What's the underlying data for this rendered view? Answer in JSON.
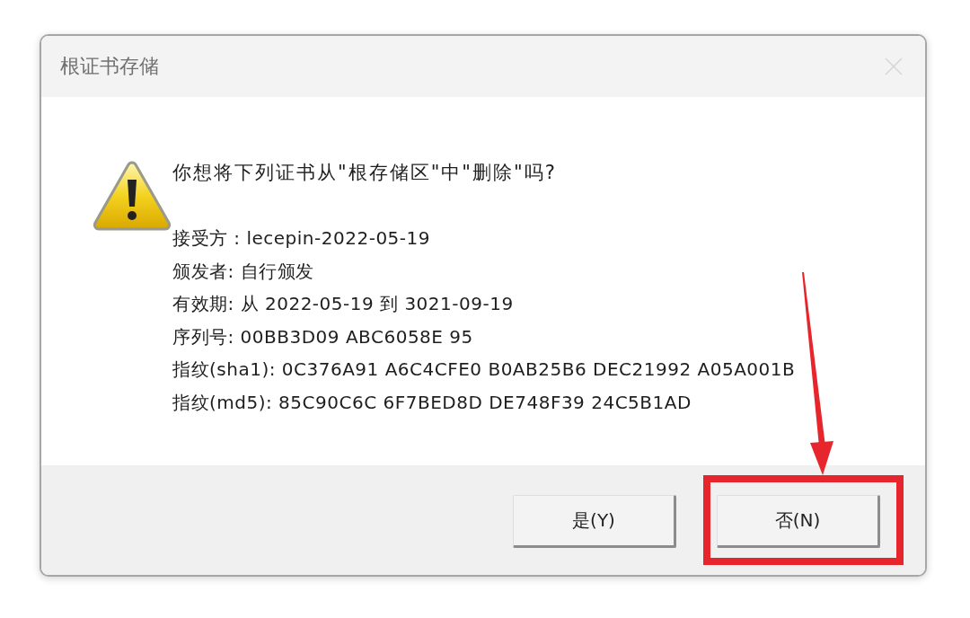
{
  "dialog": {
    "title": "根证书存储",
    "close_button": {
      "disabled": true
    },
    "message": "你想将下列证书从\"根存储区\"中\"删除\"吗?",
    "details": [
      "接受方 : lecepin-2022-05-19",
      "颁发者: 自行颁发",
      "有效期: 从 2022-05-19 到 3021-09-19",
      "序列号: 00BB3D09 ABC6058E 95",
      "指纹(sha1): 0C376A91 A6C4CFE0 B0AB25B6 DEC21992 A05A001B",
      "指纹(md5): 85C90C6C 6F7BED8D DE748F39 24C5B1AD"
    ],
    "buttons": [
      {
        "label": "是(Y)",
        "highlighted": false
      },
      {
        "label": "否(N)",
        "highlighted": true
      }
    ]
  }
}
